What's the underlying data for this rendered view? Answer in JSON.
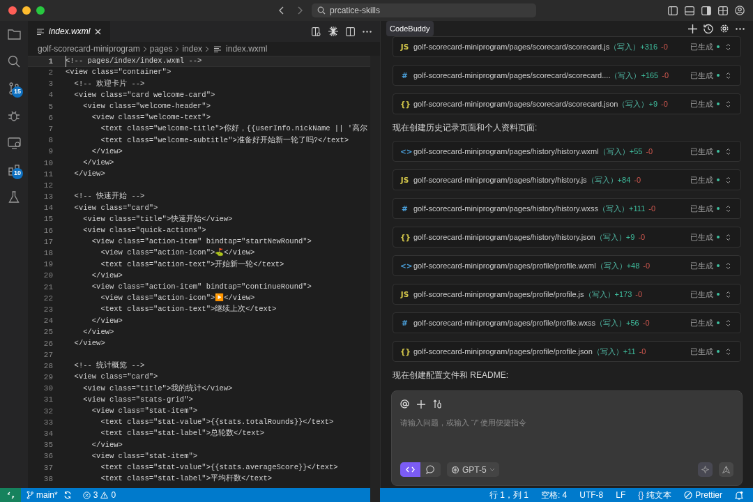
{
  "window": {
    "search": "prcatice-skills"
  },
  "activity_bar": [
    {
      "kind": "files"
    },
    {
      "kind": "search"
    },
    {
      "kind": "source-control",
      "badge": "15"
    },
    {
      "kind": "debug"
    },
    {
      "kind": "remote"
    },
    {
      "kind": "extensions",
      "badge": "10"
    },
    {
      "kind": "testing"
    }
  ],
  "editor": {
    "tabs": [
      {
        "label": "index.wxml",
        "selected": true
      }
    ],
    "breadcrumbs": [
      "golf-scorecard-miniprogram",
      "pages",
      "index",
      "index.wxml"
    ],
    "lines": [
      {
        "number": "1",
        "text": "<!-- pages/index/index.wxml -->",
        "current": true
      },
      {
        "number": "2",
        "text": "<view class=\"container\">",
        "current": false
      },
      {
        "number": "3",
        "text": "  <!-- 欢迎卡片 -->",
        "current": false
      },
      {
        "number": "4",
        "text": "  <view class=\"card welcome-card\">",
        "current": false
      },
      {
        "number": "5",
        "text": "    <view class=\"welcome-header\">",
        "current": false
      },
      {
        "number": "6",
        "text": "      <view class=\"welcome-text\">",
        "current": false
      },
      {
        "number": "7",
        "text": "        <text class=\"welcome-title\">你好，{{userInfo.nickName || '高尔",
        "current": false
      },
      {
        "number": "8",
        "text": "        <text class=\"welcome-subtitle\">准备好开始新一轮了吗?</text>",
        "current": false
      },
      {
        "number": "9",
        "text": "      </view>",
        "current": false
      },
      {
        "number": "10",
        "text": "    </view>",
        "current": false
      },
      {
        "number": "11",
        "text": "  </view>",
        "current": false
      },
      {
        "number": "12",
        "current": false
      },
      {
        "number": "13",
        "text": "  <!-- 快速开始 -->",
        "current": false
      },
      {
        "number": "14",
        "text": "  <view class=\"card\">",
        "current": false
      },
      {
        "number": "15",
        "text": "    <view class=\"title\">快速开始</view>",
        "current": false
      },
      {
        "number": "16",
        "text": "    <view class=\"quick-actions\">",
        "current": false
      },
      {
        "number": "17",
        "text": "      <view class=\"action-item\" bindtap=\"startNewRound\">",
        "current": false
      },
      {
        "number": "18",
        "text": "        <view class=\"action-icon\">⛳</view>",
        "current": false
      },
      {
        "number": "19",
        "text": "        <text class=\"action-text\">开始新一轮</text>",
        "current": false
      },
      {
        "number": "20",
        "text": "      </view>",
        "current": false
      },
      {
        "number": "21",
        "text": "      <view class=\"action-item\" bindtap=\"continueRound\">",
        "current": false
      },
      {
        "number": "22",
        "text": "        <view class=\"action-icon\">▶️</view>",
        "current": false
      },
      {
        "number": "23",
        "text": "        <text class=\"action-text\">继续上次</text>",
        "current": false
      },
      {
        "number": "24",
        "text": "      </view>",
        "current": false
      },
      {
        "number": "25",
        "text": "    </view>",
        "current": false
      },
      {
        "number": "26",
        "text": "  </view>",
        "current": false
      },
      {
        "number": "27",
        "current": false
      },
      {
        "number": "28",
        "text": "  <!-- 统计概览 -->",
        "current": false
      },
      {
        "number": "29",
        "text": "  <view class=\"card\">",
        "current": false
      },
      {
        "number": "30",
        "text": "    <view class=\"title\">我的统计</view>",
        "current": false
      },
      {
        "number": "31",
        "text": "    <view class=\"stats-grid\">",
        "current": false
      },
      {
        "number": "32",
        "text": "      <view class=\"stat-item\">",
        "current": false
      },
      {
        "number": "33",
        "text": "        <text class=\"stat-value\">{{stats.totalRounds}}</text>",
        "current": false
      },
      {
        "number": "34",
        "text": "        <text class=\"stat-label\">总轮数</text>",
        "current": false
      },
      {
        "number": "35",
        "text": "      </view>",
        "current": false
      },
      {
        "number": "36",
        "text": "      <view class=\"stat-item\">",
        "current": false
      },
      {
        "number": "37",
        "text": "        <text class=\"stat-value\">{{stats.averageScore}}</text>",
        "current": false
      },
      {
        "number": "38",
        "text": "        <text class=\"stat-label\">平均杆数</text>",
        "current": false
      }
    ]
  },
  "chat": {
    "tabs": [
      {
        "label": "CodeBuddy",
        "selected": true
      }
    ],
    "items": [
      {
        "kind": "file",
        "color": "#d4c74a",
        "glyph": "JS",
        "path": "golf-scorecard-miniprogram/pages/scorecard/scorecard.js",
        "op": "（写入）",
        "added": "+316",
        "removed": "-0",
        "status": "已生成"
      },
      {
        "kind": "file",
        "color": "#4a9ed8",
        "glyph": "#",
        "path": "golf-scorecard-miniprogram/pages/scorecard/scorecard....",
        "op": "（写入）",
        "added": "+165",
        "removed": "-0",
        "status": "已生成"
      },
      {
        "kind": "file",
        "color": "#d4c74a",
        "glyph": "{}",
        "path": "golf-scorecard-miniprogram/pages/scorecard/scorecard.json",
        "op": "（写入）",
        "added": "+9",
        "removed": "-0",
        "status": "已生成"
      },
      {
        "kind": "message",
        "text": "现在创建历史记录页面和个人资料页面:"
      },
      {
        "kind": "file",
        "color": "#4a9ed8",
        "glyph": "<>",
        "path": "golf-scorecard-miniprogram/pages/history/history.wxml",
        "op": "（写入）",
        "added": "+55",
        "removed": "-0",
        "status": "已生成"
      },
      {
        "kind": "file",
        "color": "#d4c74a",
        "glyph": "JS",
        "path": "golf-scorecard-miniprogram/pages/history/history.js",
        "op": "（写入）",
        "added": "+84",
        "removed": "-0",
        "status": "已生成"
      },
      {
        "kind": "file",
        "color": "#4a9ed8",
        "glyph": "#",
        "path": "golf-scorecard-miniprogram/pages/history/history.wxss",
        "op": "（写入）",
        "added": "+111",
        "removed": "-0",
        "status": "已生成"
      },
      {
        "kind": "file",
        "color": "#d4c74a",
        "glyph": "{}",
        "path": "golf-scorecard-miniprogram/pages/history/history.json",
        "op": "（写入）",
        "added": "+9",
        "removed": "-0",
        "status": "已生成"
      },
      {
        "kind": "file",
        "color": "#4a9ed8",
        "glyph": "<>",
        "path": "golf-scorecard-miniprogram/pages/profile/profile.wxml",
        "op": "（写入）",
        "added": "+48",
        "removed": "-0",
        "status": "已生成"
      },
      {
        "kind": "file",
        "color": "#d4c74a",
        "glyph": "JS",
        "path": "golf-scorecard-miniprogram/pages/profile/profile.js",
        "op": "（写入）",
        "added": "+173",
        "removed": "-0",
        "status": "已生成"
      },
      {
        "kind": "file",
        "color": "#4a9ed8",
        "glyph": "#",
        "path": "golf-scorecard-miniprogram/pages/profile/profile.wxss",
        "op": "（写入）",
        "added": "+56",
        "removed": "-0",
        "status": "已生成"
      },
      {
        "kind": "file",
        "color": "#d4c74a",
        "glyph": "{}",
        "path": "golf-scorecard-miniprogram/pages/profile/profile.json",
        "op": "（写入）",
        "added": "+11",
        "removed": "-0",
        "status": "已生成"
      },
      {
        "kind": "message",
        "text": "现在创建配置文件和 README:"
      }
    ],
    "input": {
      "placeholder": "请输入问题，或输入 “/” 使用便捷指令"
    },
    "modes": [
      {
        "kind": "code",
        "selected": true
      },
      {
        "kind": "chat",
        "selected": false
      }
    ],
    "model": "GPT-5"
  },
  "status_bar": {
    "branch": "main*",
    "errors": "3",
    "warnings": "0",
    "items": [
      {
        "kind": "text",
        "label": "行 1，列 1"
      },
      {
        "kind": "text",
        "label": "空格: 4"
      },
      {
        "kind": "text",
        "label": "UTF-8"
      },
      {
        "kind": "text",
        "label": "LF"
      },
      {
        "kind": "language",
        "glyph": "{}",
        "label": "纯文本"
      },
      {
        "kind": "formatter",
        "label": "Prettier"
      }
    ]
  }
}
